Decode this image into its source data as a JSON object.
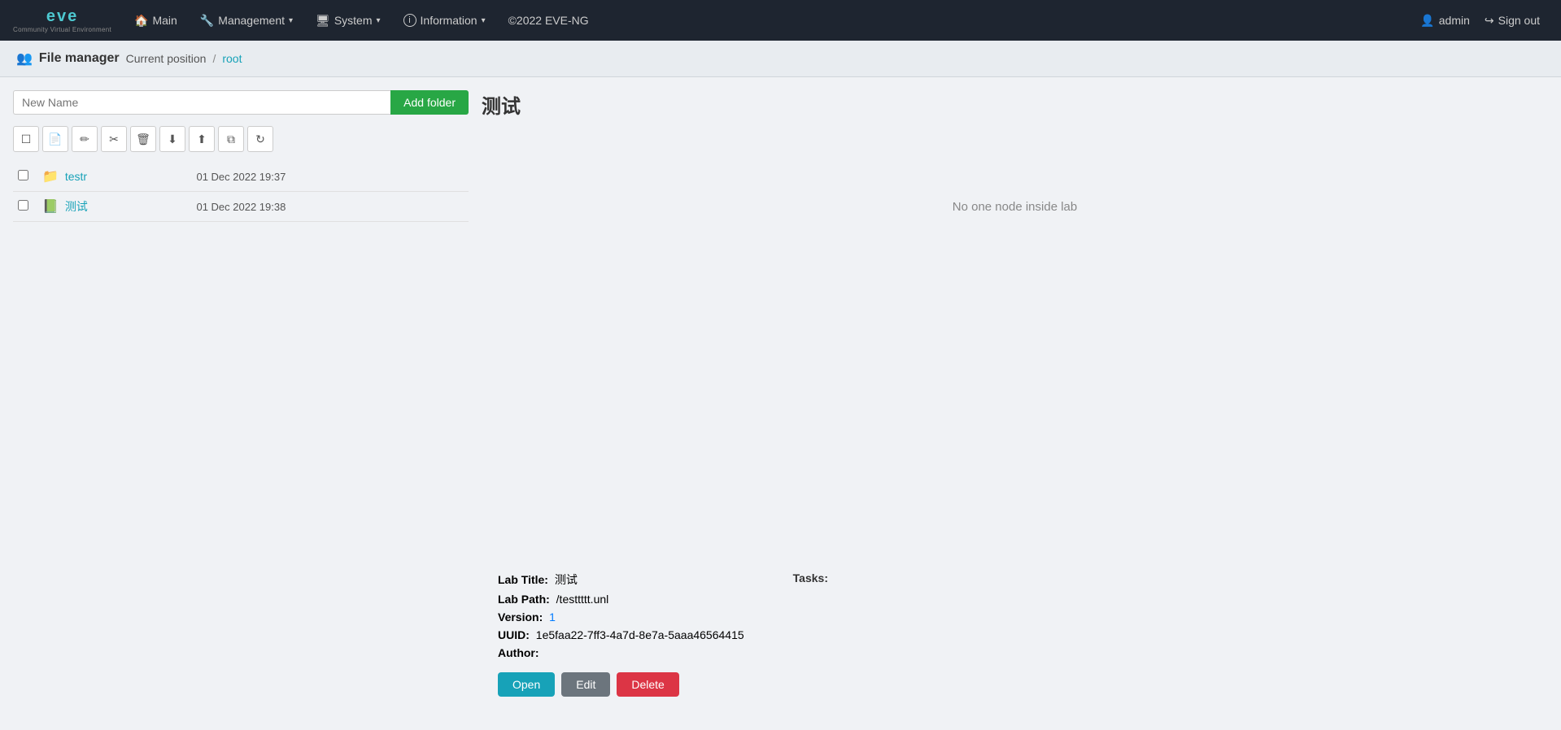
{
  "navbar": {
    "brand_title": "eve",
    "brand_sub": "Community Virtual Environment",
    "nav_main": "Main",
    "nav_management": "Management",
    "nav_system": "System",
    "nav_information": "Information",
    "nav_copyright": "©2022 EVE-NG",
    "nav_admin": "admin",
    "nav_signout": "Sign out"
  },
  "breadcrumb": {
    "fm_label": "File manager",
    "current_position": "Current position",
    "separator": "/",
    "root_link": "root"
  },
  "toolbar": {
    "add_folder_placeholder": "New Name",
    "add_folder_btn": "Add folder"
  },
  "files": [
    {
      "id": "testr",
      "name": "testr",
      "type": "folder",
      "date": "01 Dec 2022 19:37"
    },
    {
      "id": "test-lab",
      "name": "测试",
      "type": "lab",
      "date": "01 Dec 2022 19:38"
    }
  ],
  "right_panel": {
    "lab_title": "测试",
    "no_node_msg": "No one node inside lab",
    "lab_title_label": "Lab Title:",
    "lab_title_val": "测试",
    "lab_path_label": "Lab Path:",
    "lab_path_val": "/testtttt.unl",
    "version_label": "Version:",
    "version_val": "1",
    "uuid_label": "UUID:",
    "uuid_val": "1e5faa22-7ff3-4a7d-8e7a-5aaa46564415",
    "author_label": "Author:",
    "author_val": "",
    "tasks_label": "Tasks:",
    "btn_open": "Open",
    "btn_edit": "Edit",
    "btn_delete": "Delete"
  },
  "toolbar_icons": {
    "select_all": "☐",
    "new_file": "📄",
    "edit": "✏",
    "cut": "✂",
    "delete": "🗑",
    "download": "⬇",
    "upload": "⬆",
    "copy": "⧉",
    "refresh": "↻"
  }
}
